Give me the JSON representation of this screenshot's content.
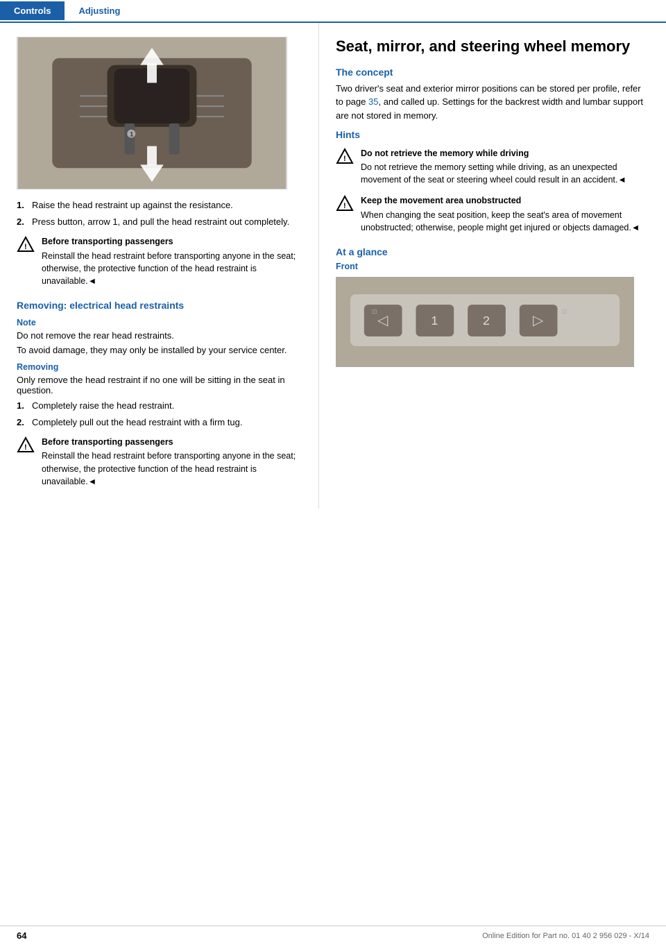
{
  "header": {
    "tab_controls": "Controls",
    "tab_adjusting": "Adjusting"
  },
  "left_col": {
    "steps_removal_manual": [
      {
        "num": "1.",
        "text": "Raise the head restraint up against the resistance."
      },
      {
        "num": "2.",
        "text": "Press button, arrow 1, and pull the head restraint out completely."
      }
    ],
    "warning_1": {
      "title": "Before transporting passengers",
      "text": "Reinstall the head restraint before transporting anyone in the seat; otherwise, the protective function of the head restraint is unavailable.◄"
    },
    "section_electrical_title": "Removing: electrical head restraints",
    "note_title": "Note",
    "note_text_1": "Do not remove the rear head restraints.",
    "note_text_2": "To avoid damage, they may only be installed by your service center.",
    "removing_title": "Removing",
    "removing_text": "Only remove the head restraint if no one will be sitting in the seat in question.",
    "steps_removal_electrical": [
      {
        "num": "1.",
        "text": "Completely raise the head restraint."
      },
      {
        "num": "2.",
        "text": "Completely pull out the head restraint with a firm tug."
      }
    ],
    "warning_2": {
      "title": "Before transporting passengers",
      "text": "Reinstall the head restraint before transporting anyone in the seat; otherwise, the protective function of the head restraint is unavailable.◄"
    }
  },
  "right_col": {
    "page_heading": "Seat, mirror, and steering wheel memory",
    "concept_title": "The concept",
    "concept_text": "Two driver's seat and exterior mirror positions can be stored per profile, refer to page",
    "concept_page_ref": "35",
    "concept_text_2": ", and called up. Settings for the backrest width and lumbar support are not stored in memory.",
    "hints_title": "Hints",
    "hint_1": {
      "title": "Do not retrieve the memory while driving",
      "text": "Do not retrieve the memory setting while driving, as an unexpected movement of the seat or steering wheel could result in an accident.◄"
    },
    "hint_2": {
      "title": "Keep the movement area unobstructed",
      "text": "When changing the seat position, keep the seat's area of movement unobstructed; otherwise, people might get injured or objects damaged.◄"
    },
    "at_glance_title": "At a glance",
    "front_title": "Front"
  },
  "footer": {
    "page_number": "64",
    "copyright": "Online Edition for Part no. 01 40 2 956 029 - X/14"
  },
  "icons": {
    "warning_triangle": "⚠"
  }
}
